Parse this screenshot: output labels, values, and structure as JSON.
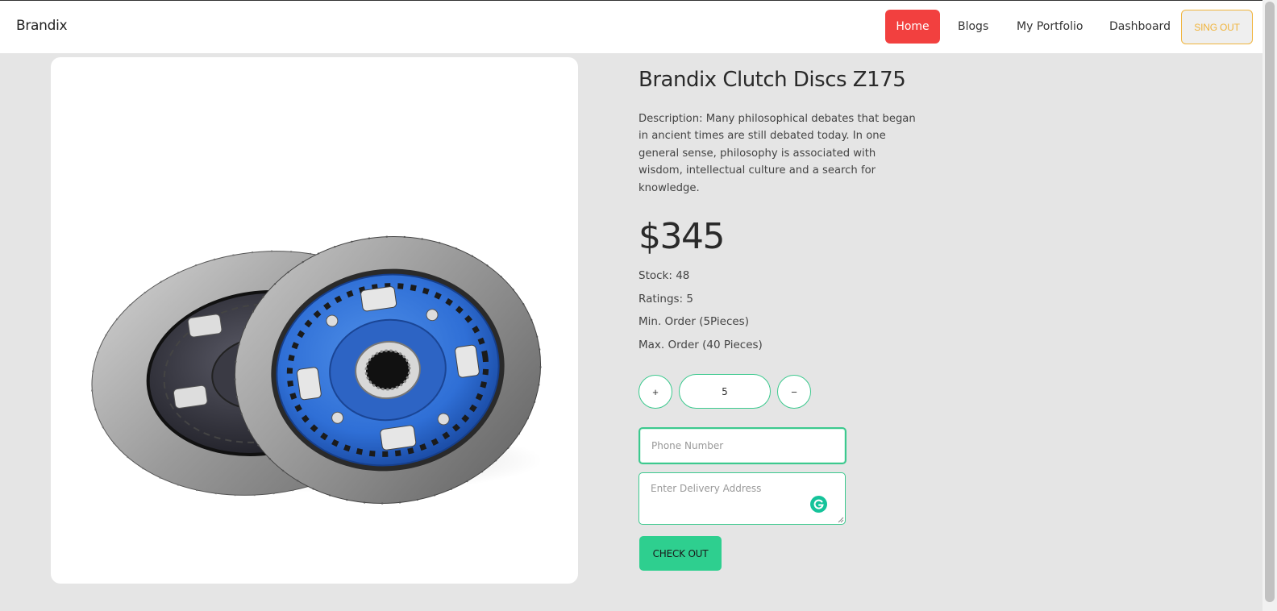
{
  "nav": {
    "brand": "Brandix",
    "links": [
      "Home",
      "Blogs",
      "My Portfolio",
      "Dashboard"
    ],
    "signout_label": "SING OUT",
    "active": "Home"
  },
  "product": {
    "title": "Brandix Clutch Discs Z175",
    "description": "Description: Many philosophical debates that began in ancient times are still debated today. In one general sense, philosophy is associated with wisdom, intellectual culture and a search for knowledge.",
    "price": "$345",
    "stock": "Stock: 48",
    "ratings": "Ratings: 5",
    "min_order": "Min. Order (5Pieces)",
    "max_order": "Max. Order (40 Pieces)"
  },
  "quantity": {
    "plus_label": "+",
    "minus_label": "−",
    "value": "5"
  },
  "form": {
    "phone_placeholder": "Phone Number",
    "address_placeholder": "Enter Delivery Address",
    "checkout_label": "CHECK OUT"
  },
  "colors": {
    "accent_green": "#3cc98e",
    "checkout_green": "#2ecf8f",
    "home_red": "#f2403f",
    "signout_yellow": "#f0b43c",
    "disc_blue": "#2f6fd6"
  }
}
